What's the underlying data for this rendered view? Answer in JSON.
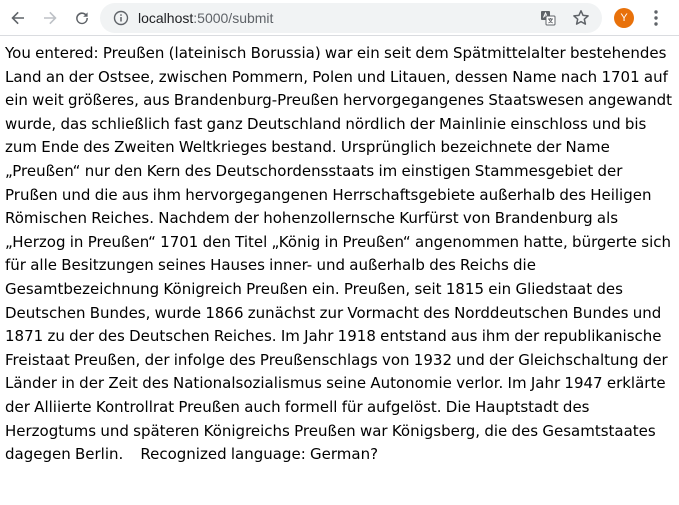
{
  "browser": {
    "url_host": "localhost",
    "url_path": ":5000/submit",
    "profile_initial": "Y",
    "accent": "#e8710a"
  },
  "icons": [
    "back-arrow-icon",
    "forward-arrow-icon",
    "reload-icon",
    "info-icon",
    "translate-icon",
    "star-icon",
    "kebab-menu-icon"
  ],
  "page": {
    "text": "You entered: Preußen (lateinisch Borussia) war ein seit dem Spätmittelalter bestehendes Land an der Ostsee, zwischen Pommern, Polen und Litauen, dessen Name nach 1701 auf ein weit größeres, aus Brandenburg-Preußen hervorgegangenes Staatswesen angewandt wurde, das schließlich fast ganz Deutschland nördlich der Mainlinie einschloss und bis zum Ende des Zweiten Weltkrieges bestand. Ursprünglich bezeichnete der Name „Preußen“ nur den Kern des Deutschordensstaats im einstigen Stammesgebiet der Prußen und die aus ihm hervorgegangenen Herrschaftsgebiete außerhalb des Heiligen Römischen Reiches. Nachdem der hohenzollernsche Kurfürst von Brandenburg als „Herzog in Preußen“ 1701 den Titel „König in Preußen“ angenommen hatte, bürgerte sich für alle Besitzungen seines Hauses inner- und außerhalb des Reichs die Gesamtbezeichnung Königreich Preußen ein. Preußen, seit 1815 ein Gliedstaat des Deutschen Bundes, wurde 1866 zunächst zur Vormacht des Norddeutschen Bundes und 1871 zu der des Deutschen Reiches. Im Jahr 1918 entstand aus ihm der republikanische Freistaat Preußen, der infolge des Preußenschlags von 1932 und der Gleichschaltung der Länder in der Zeit des Nationalsozialismus seine Autonomie verlor. Im Jahr 1947 erklärte der Alliierte Kontrollrat Preußen auch formell für aufgelöst. Die Hauptstadt des Herzogtums und späteren Königreichs Preußen war Königsberg, die des Gesamtstaates dagegen Berlin.",
    "recognized": "Recognized language: German?"
  }
}
